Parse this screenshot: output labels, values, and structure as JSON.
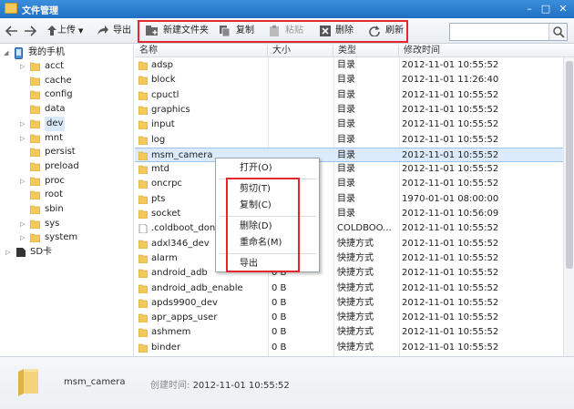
{
  "window": {
    "title": "文件管理"
  },
  "toolbar": {
    "upload": "上传",
    "export": "导出",
    "new_folder": "新建文件夹",
    "copy": "复制",
    "paste": "粘贴",
    "delete": "删除",
    "refresh": "刷新",
    "search_placeholder": ""
  },
  "sidebar": {
    "root": "我的手机",
    "items": [
      "acct",
      "cache",
      "config",
      "data",
      "dev",
      "mnt",
      "persist",
      "preload",
      "proc",
      "root",
      "sbin",
      "sys",
      "system"
    ],
    "sd": "SD卡"
  },
  "columns": {
    "name": "名称",
    "size": "大小",
    "type": "类型",
    "time": "修改时间"
  },
  "rows": [
    {
      "name": "adsp",
      "size": "",
      "type": "目录",
      "time": "2012-11-01 10:55:52"
    },
    {
      "name": "block",
      "size": "",
      "type": "目录",
      "time": "2012-11-01 11:26:40"
    },
    {
      "name": "cpuctl",
      "size": "",
      "type": "目录",
      "time": "2012-11-01 10:55:52"
    },
    {
      "name": "graphics",
      "size": "",
      "type": "目录",
      "time": "2012-11-01 10:55:52"
    },
    {
      "name": "input",
      "size": "",
      "type": "目录",
      "time": "2012-11-01 10:55:52"
    },
    {
      "name": "log",
      "size": "",
      "type": "目录",
      "time": "2012-11-01 10:55:52"
    },
    {
      "name": "msm_camera",
      "size": "",
      "type": "目录",
      "time": "2012-11-01 10:55:52"
    },
    {
      "name": "mtd",
      "size": "",
      "type": "目录",
      "time": "2012-11-01 10:55:52"
    },
    {
      "name": "oncrpc",
      "size": "",
      "type": "目录",
      "time": "2012-11-01 10:55:52"
    },
    {
      "name": "pts",
      "size": "",
      "type": "目录",
      "time": "1970-01-01 08:00:00"
    },
    {
      "name": "socket",
      "size": "",
      "type": "目录",
      "time": "2012-11-01 10:56:09"
    },
    {
      "name": ".coldboot_done",
      "size": "",
      "type": "COLDBOO...",
      "time": "2012-11-01 10:55:52"
    },
    {
      "name": "adxl346_dev",
      "size": "",
      "type": "快捷方式",
      "time": "2012-11-01 10:55:52"
    },
    {
      "name": "alarm",
      "size": "",
      "type": "快捷方式",
      "time": "2012-11-01 10:55:52"
    },
    {
      "name": "android_adb",
      "size": "0 B",
      "type": "快捷方式",
      "time": "2012-11-01 10:55:52"
    },
    {
      "name": "android_adb_enable",
      "size": "0 B",
      "type": "快捷方式",
      "time": "2012-11-01 10:55:52"
    },
    {
      "name": "apds9900_dev",
      "size": "0 B",
      "type": "快捷方式",
      "time": "2012-11-01 10:55:52"
    },
    {
      "name": "apr_apps_user",
      "size": "0 B",
      "type": "快捷方式",
      "time": "2012-11-01 10:55:52"
    },
    {
      "name": "ashmem",
      "size": "0 B",
      "type": "快捷方式",
      "time": "2012-11-01 10:55:52"
    },
    {
      "name": "binder",
      "size": "0 B",
      "type": "快捷方式",
      "time": "2012-11-01 10:55:52"
    }
  ],
  "context_menu": {
    "open": "打开(O)",
    "cut": "剪切(T)",
    "copy": "复制(C)",
    "delete": "删除(D)",
    "rename": "重命名(M)",
    "export": "导出"
  },
  "status": {
    "name": "msm_camera",
    "created_label": "创建时间:",
    "created_value": "2012-11-01 10:55:52"
  },
  "colors": {
    "titlebar": "#2a7fd4",
    "highlight": "#e2282c",
    "selection": "#dcebfb",
    "folder": "#f2c95a"
  },
  "icons": [
    "back-arrow-icon",
    "forward-arrow-icon",
    "upload-icon",
    "export-icon",
    "new-folder-icon",
    "copy-icon",
    "paste-icon",
    "delete-icon",
    "refresh-icon",
    "search-icon",
    "phone-icon",
    "sd-card-icon",
    "folder-icon",
    "file-icon"
  ]
}
